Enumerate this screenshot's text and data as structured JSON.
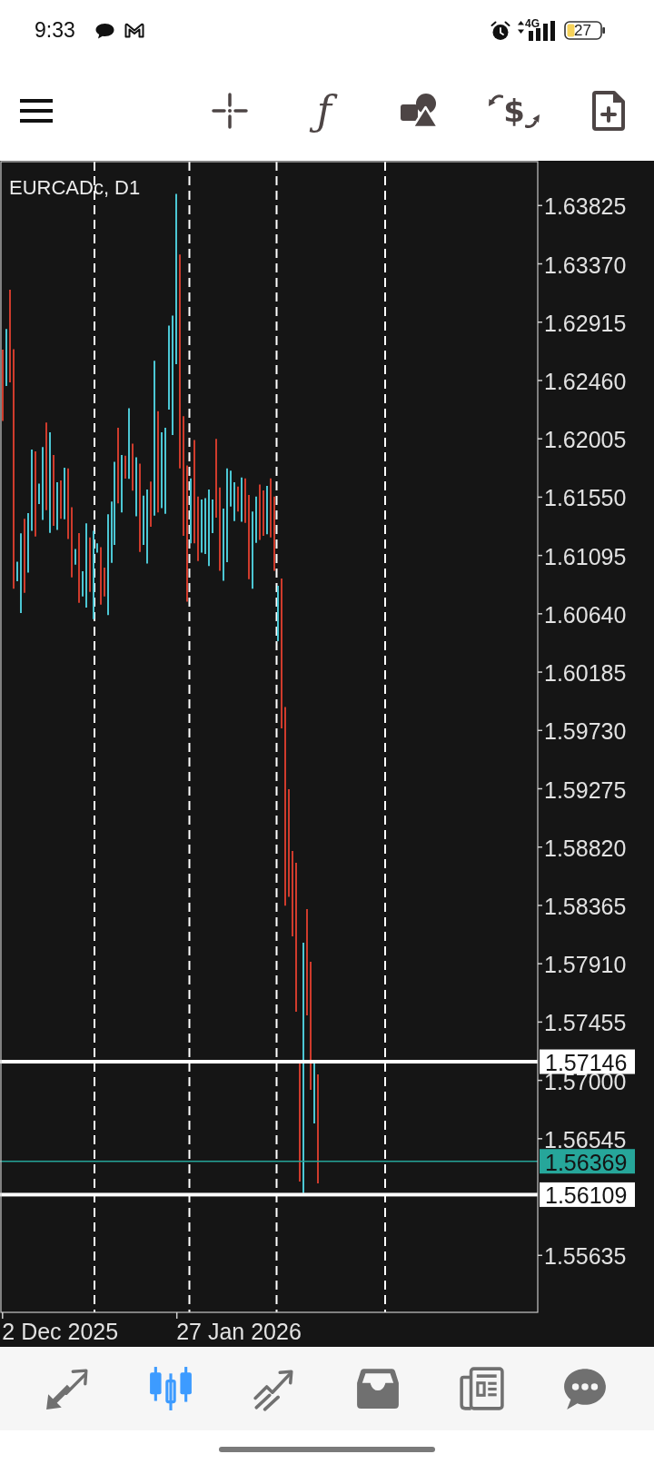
{
  "status_bar": {
    "time": "9:33",
    "network": "4G",
    "battery": "27"
  },
  "toolbar": {
    "function_symbol": "ƒ",
    "currency_symbol": "$"
  },
  "chart": {
    "title": "EURCADc, D1",
    "price_axis": [
      "1.63825",
      "1.63370",
      "1.62915",
      "1.62460",
      "1.62005",
      "1.61550",
      "1.61095",
      "1.60640",
      "1.60185",
      "1.59730",
      "1.59275",
      "1.58820",
      "1.58365",
      "1.57910",
      "1.57455",
      "1.57000",
      "1.56545",
      "1.55635"
    ],
    "time_axis": [
      "2 Dec 2025",
      "27 Jan 2026"
    ],
    "price_tags": [
      {
        "kind": "level",
        "text": "1.57146"
      },
      {
        "kind": "bid",
        "text": "1.56369"
      },
      {
        "kind": "level",
        "text": "1.56109"
      }
    ]
  },
  "bottom_nav": [
    {
      "selected": false
    },
    {
      "selected": true
    },
    {
      "selected": false
    },
    {
      "selected": false
    },
    {
      "selected": false
    },
    {
      "selected": false
    }
  ]
}
